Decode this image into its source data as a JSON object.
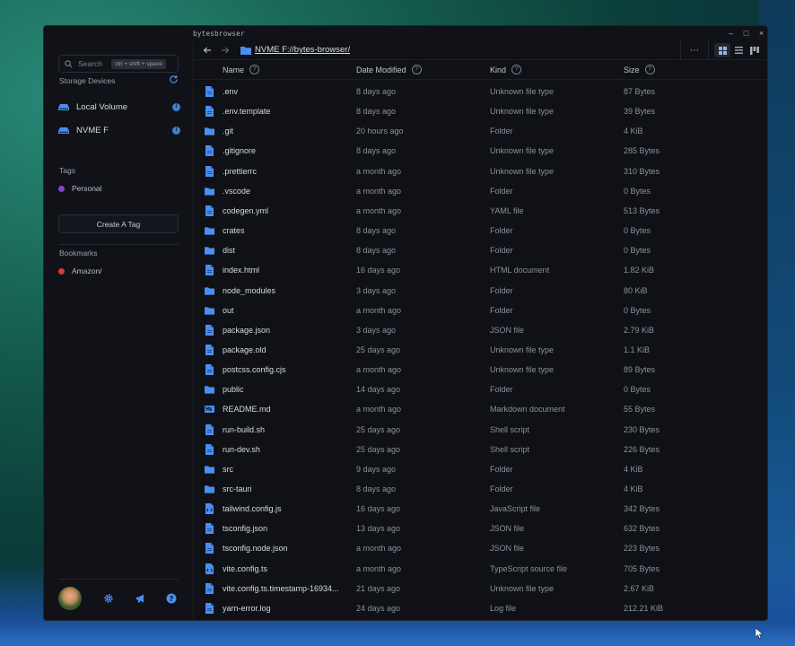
{
  "window": {
    "title": "bytesbrowser",
    "controls": {
      "minimize": "–",
      "maximize": "□",
      "close": "×"
    }
  },
  "sidebar": {
    "search": {
      "placeholder": "Search",
      "shortcut": "ctrl + shift + space"
    },
    "storage": {
      "title": "Storage Devices",
      "devices": [
        {
          "label": "Local Volume",
          "info": "i"
        },
        {
          "label": "NVME F",
          "info": "i"
        }
      ]
    },
    "tags": {
      "title": "Tags",
      "items": [
        {
          "label": "Personal",
          "color": "#8b3fd9"
        }
      ],
      "create_label": "Create A Tag"
    },
    "bookmarks": {
      "title": "Bookmarks",
      "items": [
        {
          "label": "Amazon/",
          "color": "#d93a3a"
        }
      ]
    }
  },
  "toolbar": {
    "path": "NVME F://bytes-browser/",
    "more": "⋯"
  },
  "columns": {
    "name": "Name",
    "date": "Date Modified",
    "kind": "Kind",
    "size": "Size",
    "help": "?"
  },
  "files": [
    {
      "name": ".env",
      "date": "8 days ago",
      "kind": "Unknown file type",
      "size": "87 Bytes",
      "icon": "file"
    },
    {
      "name": ".env.template",
      "date": "8 days ago",
      "kind": "Unknown file type",
      "size": "39 Bytes",
      "icon": "file"
    },
    {
      "name": ".git",
      "date": "20 hours ago",
      "kind": "Folder",
      "size": "4 KiB",
      "icon": "folder"
    },
    {
      "name": ".gitignore",
      "date": "8 days ago",
      "kind": "Unknown file type",
      "size": "285 Bytes",
      "icon": "file"
    },
    {
      "name": ".prettierrc",
      "date": "a month ago",
      "kind": "Unknown file type",
      "size": "310 Bytes",
      "icon": "file"
    },
    {
      "name": ".vscode",
      "date": "a month ago",
      "kind": "Folder",
      "size": "0 Bytes",
      "icon": "folder"
    },
    {
      "name": "codegen.yml",
      "date": "a month ago",
      "kind": "YAML file",
      "size": "513 Bytes",
      "icon": "file"
    },
    {
      "name": "crates",
      "date": "8 days ago",
      "kind": "Folder",
      "size": "0 Bytes",
      "icon": "folder"
    },
    {
      "name": "dist",
      "date": "8 days ago",
      "kind": "Folder",
      "size": "0 Bytes",
      "icon": "folder"
    },
    {
      "name": "index.html",
      "date": "16 days ago",
      "kind": "HTML document",
      "size": "1.82 KiB",
      "icon": "file"
    },
    {
      "name": "node_modules",
      "date": "3 days ago",
      "kind": "Folder",
      "size": "80 KiB",
      "icon": "folder"
    },
    {
      "name": "out",
      "date": "a month ago",
      "kind": "Folder",
      "size": "0 Bytes",
      "icon": "folder"
    },
    {
      "name": "package.json",
      "date": "3 days ago",
      "kind": "JSON file",
      "size": "2.79 KiB",
      "icon": "file"
    },
    {
      "name": "package.old",
      "date": "25 days ago",
      "kind": "Unknown file type",
      "size": "1.1 KiB",
      "icon": "file"
    },
    {
      "name": "postcss.config.cjs",
      "date": "a month ago",
      "kind": "Unknown file type",
      "size": "89 Bytes",
      "icon": "file"
    },
    {
      "name": "public",
      "date": "14 days ago",
      "kind": "Folder",
      "size": "0 Bytes",
      "icon": "folder"
    },
    {
      "name": "README.md",
      "date": "a month ago",
      "kind": "Markdown document",
      "size": "55 Bytes",
      "icon": "markdown"
    },
    {
      "name": "run-build.sh",
      "date": "25 days ago",
      "kind": "Shell script",
      "size": "230 Bytes",
      "icon": "file"
    },
    {
      "name": "run-dev.sh",
      "date": "25 days ago",
      "kind": "Shell script",
      "size": "226 Bytes",
      "icon": "file"
    },
    {
      "name": "src",
      "date": "9 days ago",
      "kind": "Folder",
      "size": "4 KiB",
      "icon": "folder"
    },
    {
      "name": "src-tauri",
      "date": "8 days ago",
      "kind": "Folder",
      "size": "4 KiB",
      "icon": "folder"
    },
    {
      "name": "tailwind.config.js",
      "date": "16 days ago",
      "kind": "JavaScript file",
      "size": "342 Bytes",
      "icon": "code"
    },
    {
      "name": "tsconfig.json",
      "date": "13 days ago",
      "kind": "JSON file",
      "size": "632 Bytes",
      "icon": "file"
    },
    {
      "name": "tsconfig.node.json",
      "date": "a month ago",
      "kind": "JSON file",
      "size": "223 Bytes",
      "icon": "file"
    },
    {
      "name": "vite.config.ts",
      "date": "a month ago",
      "kind": "TypeScript source file",
      "size": "705 Bytes",
      "icon": "code"
    },
    {
      "name": "vite.config.ts.timestamp-16934...",
      "date": "21 days ago",
      "kind": "Unknown file type",
      "size": "2.67 KiB",
      "icon": "file"
    },
    {
      "name": "yarn-error.log",
      "date": "24 days ago",
      "kind": "Log file",
      "size": "212.21 KiB",
      "icon": "file"
    }
  ],
  "colors": {
    "accent": "#3d86e8",
    "folder": "#4a8ff0",
    "window_bg": "#101218"
  }
}
